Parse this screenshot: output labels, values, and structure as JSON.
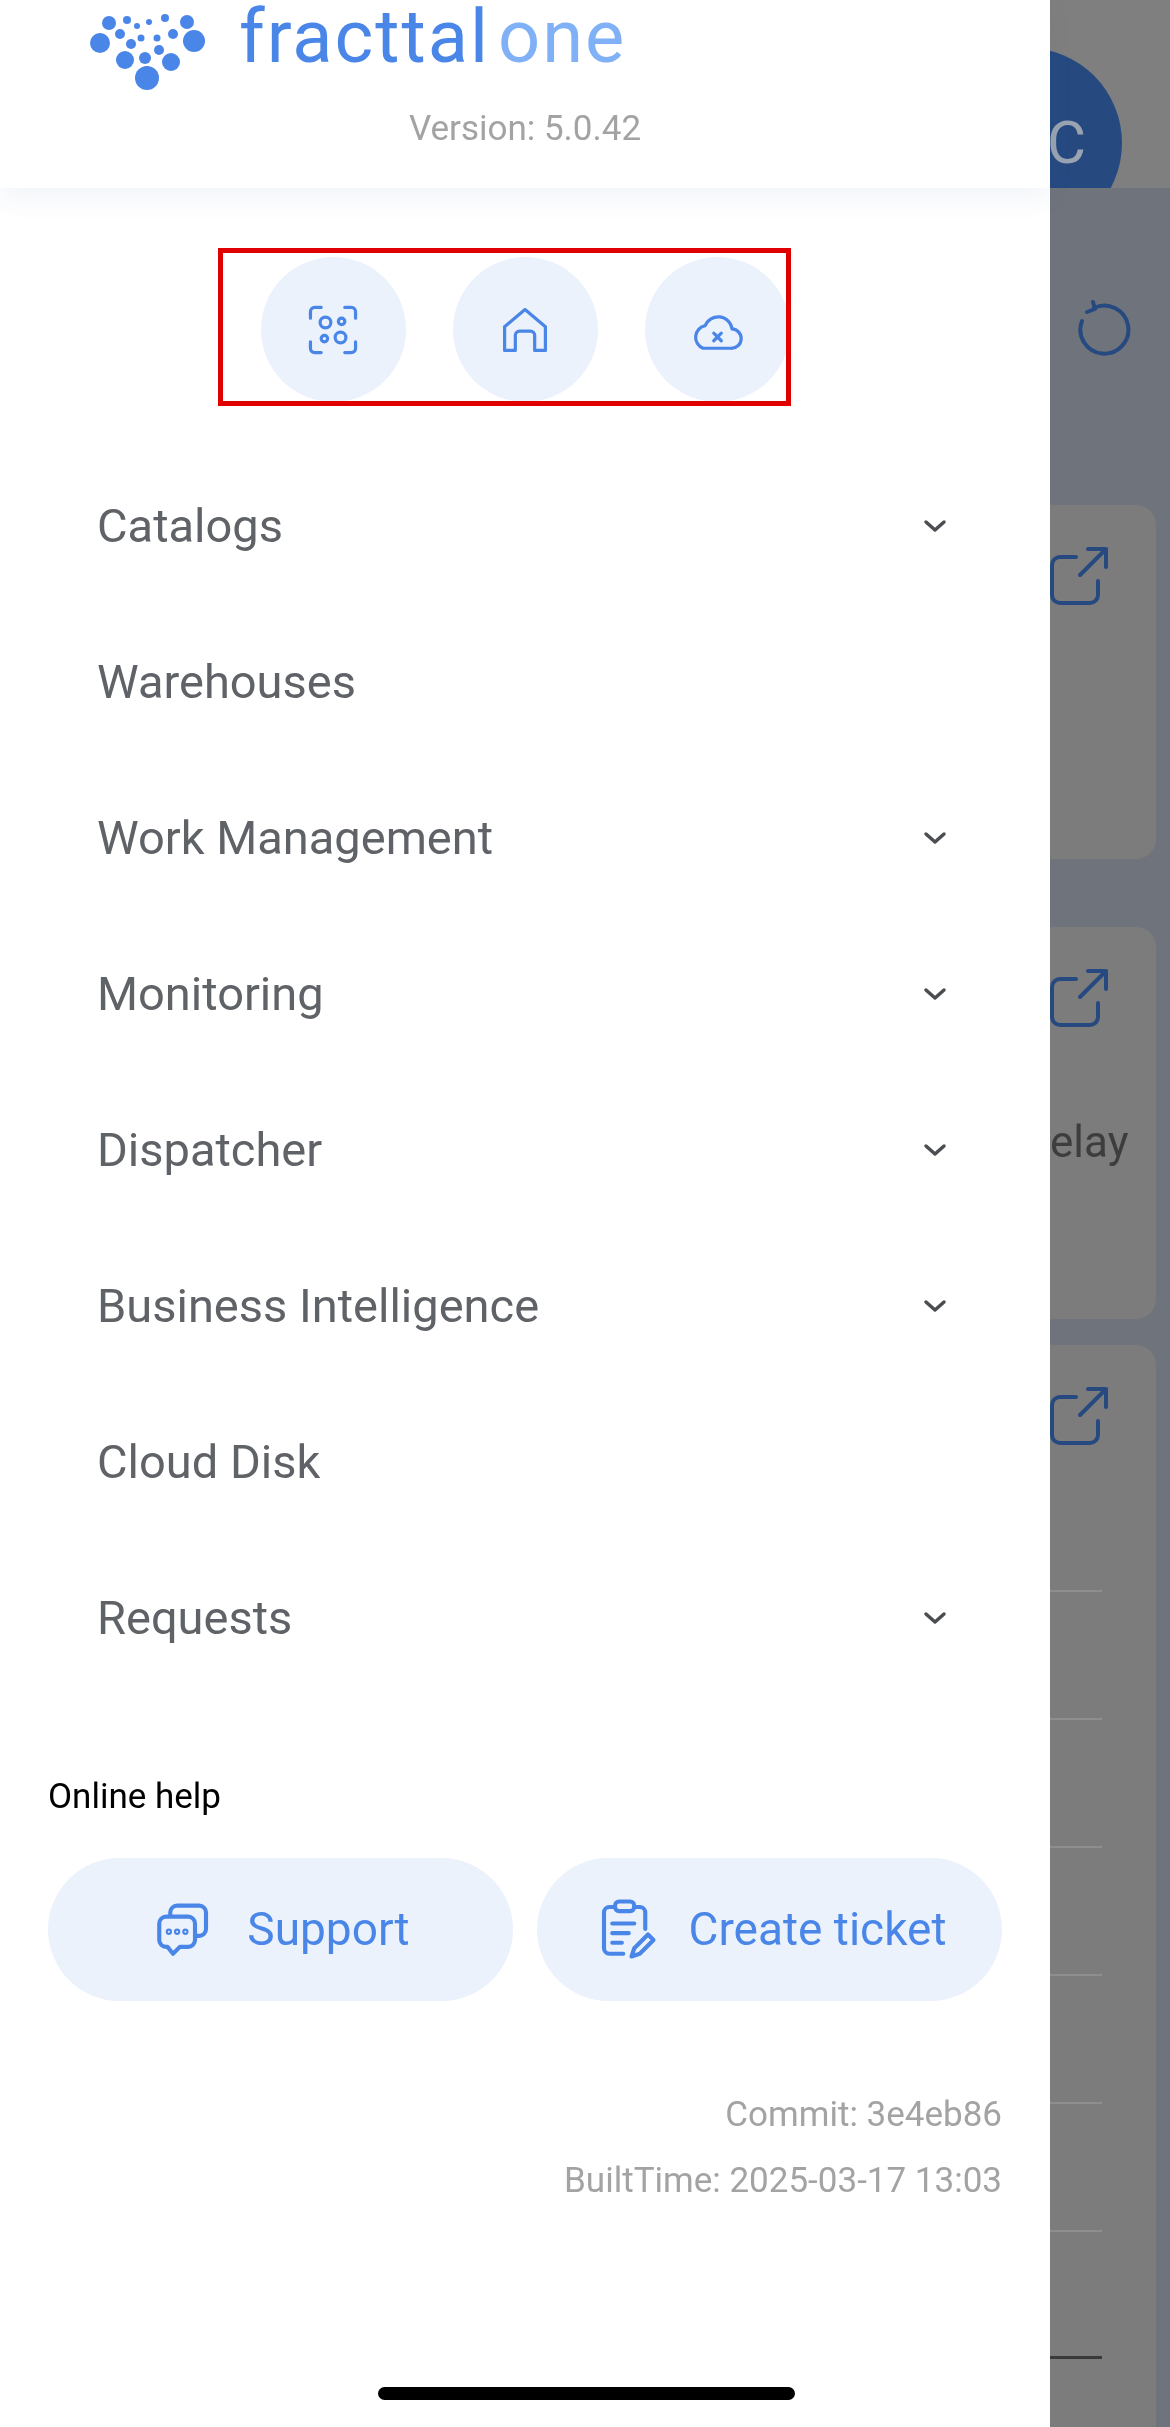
{
  "logo": {
    "word_1": "fracttal",
    "word_2": "one"
  },
  "version": "Version: 5.0.42",
  "quick_actions": [
    {
      "kind": "scan"
    },
    {
      "kind": "home"
    },
    {
      "kind": "cloud_off"
    }
  ],
  "menu": [
    {
      "label": "Catalogs",
      "expandable": true
    },
    {
      "label": "Warehouses",
      "expandable": false
    },
    {
      "label": "Work Management",
      "expandable": true
    },
    {
      "label": "Monitoring",
      "expandable": true
    },
    {
      "label": "Dispatcher",
      "expandable": true
    },
    {
      "label": "Business Intelligence",
      "expandable": true
    },
    {
      "label": "Cloud Disk",
      "expandable": false
    },
    {
      "label": "Requests",
      "expandable": true
    }
  ],
  "online_help": {
    "title": "Online help",
    "buttons": [
      {
        "kind": "support",
        "label": "Support"
      },
      {
        "kind": "ticket",
        "label": "Create ticket"
      }
    ]
  },
  "commit": "Commit: 3e4eb86",
  "built_time": "BuiltTime: 2025-03-17 13:03",
  "background": {
    "avatar": "C",
    "cards": [
      {
        "kind": "plain"
      },
      {
        "kind": "text",
        "text": "elay"
      },
      {
        "kind": "lines"
      }
    ]
  }
}
